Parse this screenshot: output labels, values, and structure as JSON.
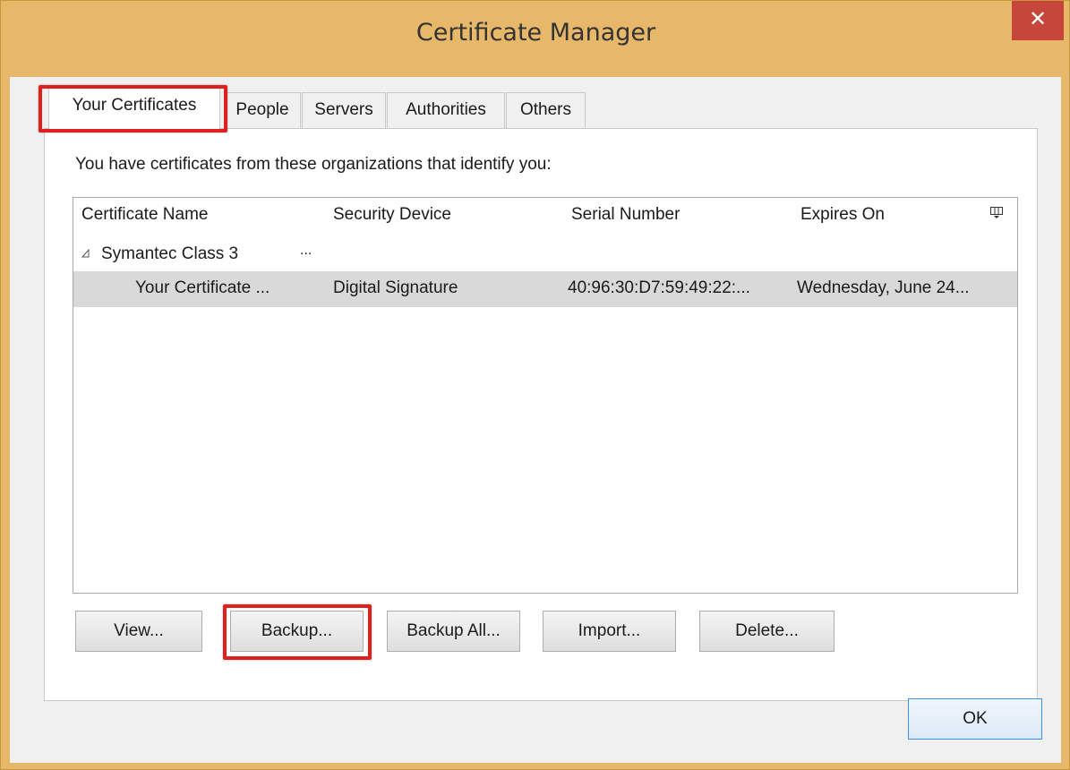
{
  "window": {
    "title": "Certificate Manager",
    "close_label": "✕"
  },
  "tabs": [
    {
      "label": "Your Certificates",
      "selected": true
    },
    {
      "label": "People",
      "selected": false
    },
    {
      "label": "Servers",
      "selected": false
    },
    {
      "label": "Authorities",
      "selected": false
    },
    {
      "label": "Others",
      "selected": false
    }
  ],
  "panel": {
    "intro_text": "You have certificates from these organizations that identify you:"
  },
  "table": {
    "columns": [
      "Certificate Name",
      "Security Device",
      "Serial Number",
      "Expires On"
    ],
    "group": {
      "name": "Symantec Class 3",
      "ellipsis": "...",
      "expanded": true
    },
    "rows": [
      {
        "certificate_name": "Your Certificate ...",
        "security_device": "Digital Signature",
        "serial_number": "40:96:30:D7:59:49:22:...",
        "expires_on": "Wednesday, June 24...",
        "selected": true
      }
    ]
  },
  "buttons": {
    "view": "View...",
    "backup": "Backup...",
    "backup_all": "Backup All...",
    "import": "Import...",
    "delete": "Delete...",
    "ok": "OK"
  },
  "colors": {
    "frame": "#e8b86a",
    "close": "#c7463b",
    "highlight": "#e02020",
    "selection": "#d9d9d9"
  },
  "icons": {
    "close": "close-icon",
    "expand": "expand-triangle-icon",
    "column_picker": "column-picker-icon"
  }
}
